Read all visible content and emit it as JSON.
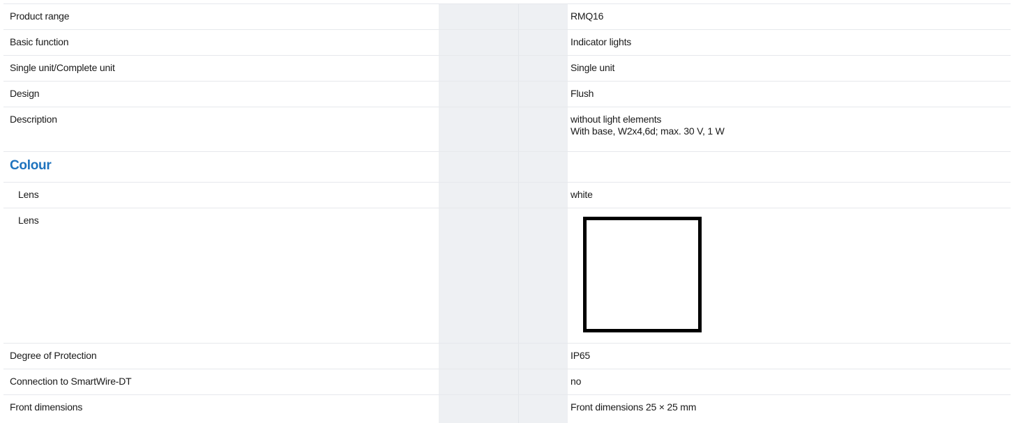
{
  "rows": [
    {
      "label": "Product range",
      "value": "RMQ16"
    },
    {
      "label": "Basic function",
      "value": "Indicator lights"
    },
    {
      "label": "Single unit/Complete unit",
      "value": "Single unit"
    },
    {
      "label": "Design",
      "value": "Flush"
    },
    {
      "label": "Description",
      "value_line1": "without light elements",
      "value_line2": "With base, W2x4,6d; max. 30 V, 1 W"
    }
  ],
  "section": {
    "title": "Colour"
  },
  "colour_rows": [
    {
      "label": "Lens",
      "value": "white"
    },
    {
      "label": "Lens",
      "swatch_color": "#ffffff",
      "swatch_border": "#000000"
    }
  ],
  "rows_after": [
    {
      "label": "Degree of Protection",
      "value": "IP65"
    },
    {
      "label": "Connection to SmartWire-DT",
      "value": "no"
    },
    {
      "label": "Front dimensions",
      "value": "Front dimensions 25 × 25 mm"
    }
  ],
  "colors": {
    "accent": "#1e73be",
    "band": "#eef0f3",
    "divider": "#e6e8ec"
  }
}
